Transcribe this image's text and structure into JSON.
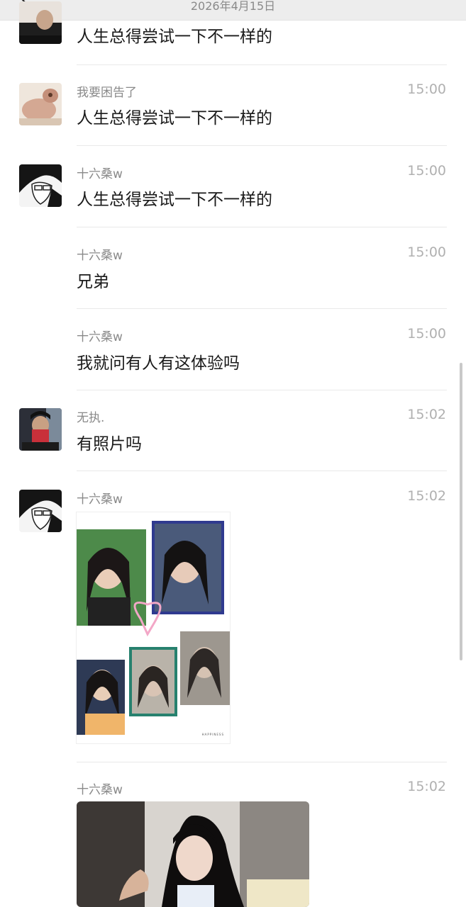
{
  "header": {
    "date": "2026年4月15日"
  },
  "messages": [
    {
      "name": "",
      "text": "人生总得尝试一下不一样的",
      "time": ""
    },
    {
      "name": "我要困告了",
      "text": "人生总得尝试一下不一样的",
      "time": "15:00"
    },
    {
      "name": "十六桑w",
      "text": "人生总得尝试一下不一样的",
      "time": "15:00"
    },
    {
      "name": "十六桑w",
      "text": "兄弟",
      "time": "15:00"
    },
    {
      "name": "十六桑w",
      "text": "我就问有人有这体验吗",
      "time": "15:00"
    },
    {
      "name": "无执.",
      "text": "有照片吗",
      "time": "15:02"
    },
    {
      "name": "十六桑w",
      "time": "15:02",
      "collage_caption": "HAPPINESS"
    },
    {
      "name": "十六桑w",
      "time": "15:02"
    }
  ]
}
